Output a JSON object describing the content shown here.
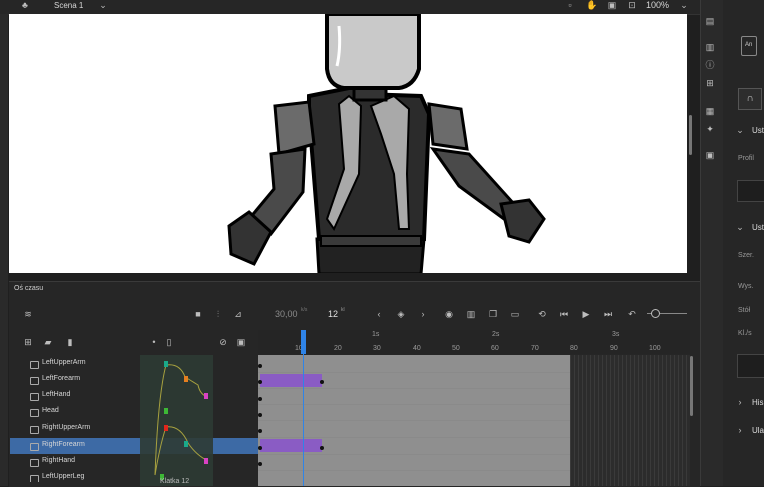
{
  "top_bar": {
    "scene_label": "Scena 1",
    "zoom": "100%"
  },
  "timeline": {
    "panel_title": "Oś czasu",
    "fps": "30,00",
    "fps_unit": "k/s",
    "current_frame": "12",
    "frame_unit": "kl",
    "ruler_seconds": [
      "1s",
      "2s",
      "3s"
    ],
    "ruler_frames": [
      "10",
      "20",
      "30",
      "40",
      "50",
      "60",
      "70",
      "80",
      "90",
      "100"
    ],
    "frame_footer": "Klatka 12",
    "layers": [
      "LeftUpperArm",
      "LeftForearm",
      "LeftHand",
      "Head",
      "RightUpperArm",
      "RightForearm",
      "RightHand",
      "LeftUpperLeg"
    ],
    "selected_layer": "RightForearm"
  },
  "properties_panel": {
    "icon_label": "An",
    "sections": [
      {
        "label": "Ust",
        "items": [
          "Profil"
        ]
      },
      {
        "label": "Ust",
        "items": [
          "Szer.",
          "Wys.",
          "Stół",
          "Kl./s"
        ]
      },
      {
        "label": "His",
        "items": []
      },
      {
        "label": "Ula",
        "items": []
      }
    ]
  },
  "colors": {
    "selected_row": "#3d6aa5",
    "tween_span": "#8a5cc4",
    "playhead": "#2f84e8",
    "accent_pink": "#d942c3",
    "accent_green": "#3db836",
    "accent_orange": "#e57f20",
    "accent_red": "#e1261c",
    "accent_teal": "#1aa98a"
  }
}
